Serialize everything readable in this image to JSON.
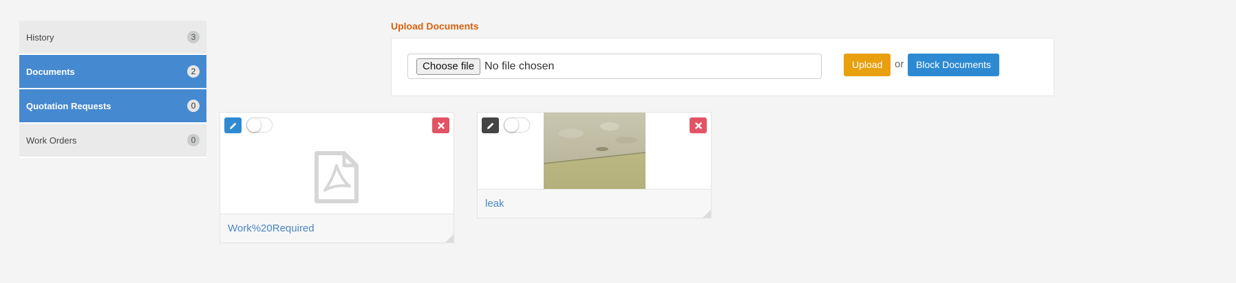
{
  "sidebar": {
    "items": [
      {
        "label": "History",
        "count": "3",
        "active": false
      },
      {
        "label": "Documents",
        "count": "2",
        "active": true
      },
      {
        "label": "Quotation Requests",
        "count": "0",
        "active": true
      },
      {
        "label": "Work Orders",
        "count": "0",
        "active": false
      }
    ]
  },
  "upload": {
    "title": "Upload Documents",
    "choose_label": "Choose file",
    "file_status": "No file chosen",
    "upload_label": "Upload",
    "or_text": "or",
    "block_label": "Block Documents"
  },
  "documents": [
    {
      "name": "Work%20Required",
      "type": "pdf",
      "icon": "pdf-file-icon"
    },
    {
      "name": "leak",
      "type": "image",
      "icon": "image-thumbnail"
    }
  ],
  "colors": {
    "accent": "#4589d0",
    "upload_title": "#d8600f",
    "upload_button": "#e8a00f",
    "block_button": "#2d8ad2",
    "delete_button": "#e25364"
  }
}
